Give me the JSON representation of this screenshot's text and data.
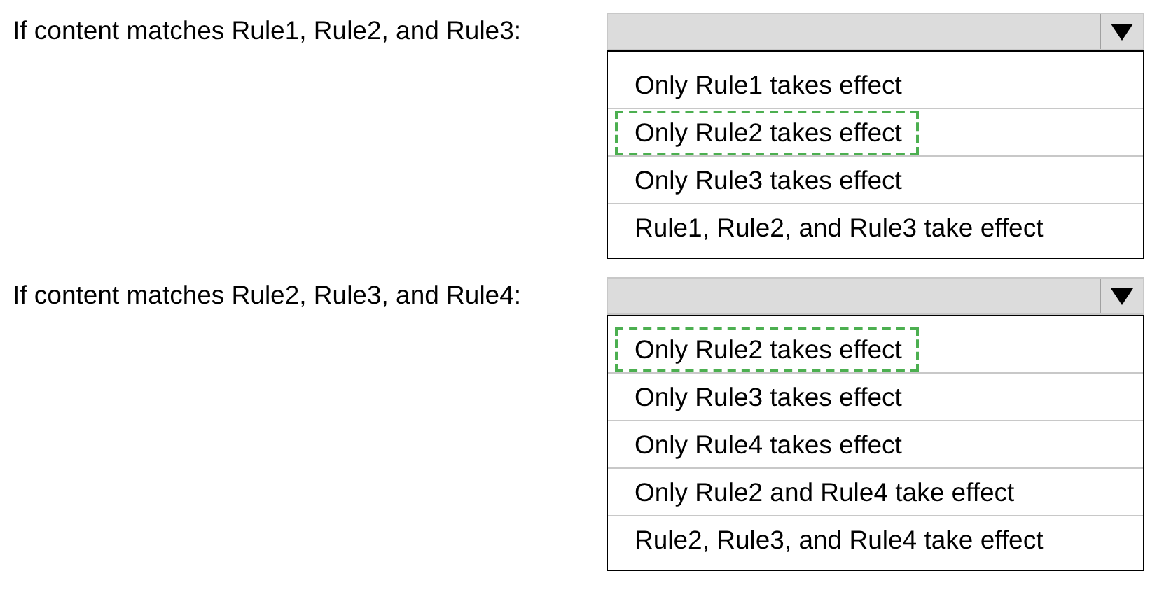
{
  "questions": [
    {
      "label": "If content matches Rule1, Rule2, and Rule3:",
      "options": [
        {
          "text": "Only Rule1 takes effect",
          "selected": false
        },
        {
          "text": "Only Rule2 takes effect",
          "selected": true
        },
        {
          "text": "Only Rule3 takes effect",
          "selected": false
        },
        {
          "text": "Rule1, Rule2, and Rule3 take effect",
          "selected": false
        }
      ]
    },
    {
      "label": "If content matches Rule2, Rule3, and Rule4:",
      "options": [
        {
          "text": "Only Rule2 takes effect",
          "selected": true
        },
        {
          "text": "Only Rule3 takes effect",
          "selected": false
        },
        {
          "text": "Only Rule4 takes effect",
          "selected": false
        },
        {
          "text": "Only Rule2 and Rule4 take effect",
          "selected": false
        },
        {
          "text": "Rule2, Rule3, and Rule4 take effect",
          "selected": false
        }
      ]
    }
  ]
}
